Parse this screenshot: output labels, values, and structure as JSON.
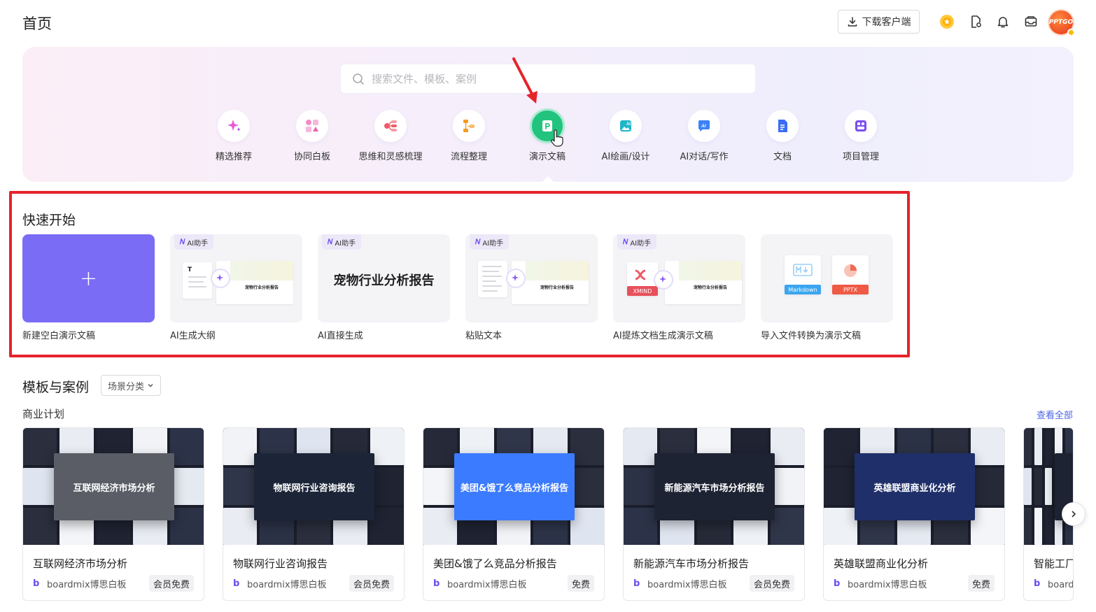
{
  "header": {
    "title": "首页",
    "download_label": "下载客户端",
    "avatar_text": "PPTGO"
  },
  "search": {
    "placeholder": "搜索文件、模板、案例"
  },
  "categories": [
    {
      "label": "精选推荐",
      "icon": "sparkle-icon",
      "color": "#e85bd8"
    },
    {
      "label": "协同白板",
      "icon": "whiteboard-icon",
      "color": "#f07fc5"
    },
    {
      "label": "思维和灵感梳理",
      "icon": "mindmap-icon",
      "color": "#ef5b68"
    },
    {
      "label": "流程整理",
      "icon": "flowchart-icon",
      "color": "#f59a23"
    },
    {
      "label": "演示文稿",
      "icon": "presentation-icon",
      "color": "#22c37e"
    },
    {
      "label": "AI绘画/设计",
      "icon": "ai-image-icon",
      "color": "#1fb6c9"
    },
    {
      "label": "AI对话/写作",
      "icon": "ai-chat-icon",
      "color": "#3b82f6"
    },
    {
      "label": "文档",
      "icon": "document-icon",
      "color": "#3b6cf6"
    },
    {
      "label": "项目管理",
      "icon": "project-icon",
      "color": "#7b4df0"
    }
  ],
  "quick_start": {
    "title": "快速开始",
    "ai_badge": "AI助手",
    "preview_text": "宠物行业分析报告",
    "blank_symbol": "+",
    "cards": [
      {
        "label": "新建空白演示文稿"
      },
      {
        "label": "AI生成大纲"
      },
      {
        "label": "AI直接生成"
      },
      {
        "label": "粘贴文本"
      },
      {
        "label": "AI提炼文档生成演示文稿"
      },
      {
        "label": "导入文件转换为演示文稿"
      }
    ],
    "file_tags": {
      "xmind": "XMIND",
      "markdown": "Markdown",
      "pptx": "PPTX"
    }
  },
  "templates": {
    "title": "模板与案例",
    "filter_label": "场景分类",
    "subsection": "商业计划",
    "see_all": "查看全部",
    "cards": [
      {
        "title": "互联网经济市场分析",
        "thumb_text": "互联网经济市场分析",
        "author": "boardmix博思白板",
        "badge": "会员免费",
        "center_bg": "#5a5d66"
      },
      {
        "title": "物联网行业咨询报告",
        "thumb_text": "物联网行业咨询报告",
        "author": "boardmix博思白板",
        "badge": "会员免费",
        "center_bg": "#1c2538"
      },
      {
        "title": "美团&饿了么竞品分析报告",
        "thumb_text": "美团&饿了么竞品分析报告",
        "author": "boardmix博思白板",
        "badge": "免费",
        "center_bg": "#3b7bff"
      },
      {
        "title": "新能源汽车市场分析报告",
        "thumb_text": "新能源汽车市场分析报告",
        "author": "boardmix博思白板",
        "badge": "会员免费",
        "center_bg": "#1d2333"
      },
      {
        "title": "英雄联盟商业化分析",
        "thumb_text": "英雄联盟商业化分析",
        "author": "boardmix博思白板",
        "badge": "免费",
        "center_bg": "#1f2f6a"
      },
      {
        "title": "智能工厂",
        "thumb_text": "智能",
        "author": "boardmix博思白板",
        "badge": "",
        "center_bg": "#1d2333"
      }
    ]
  }
}
